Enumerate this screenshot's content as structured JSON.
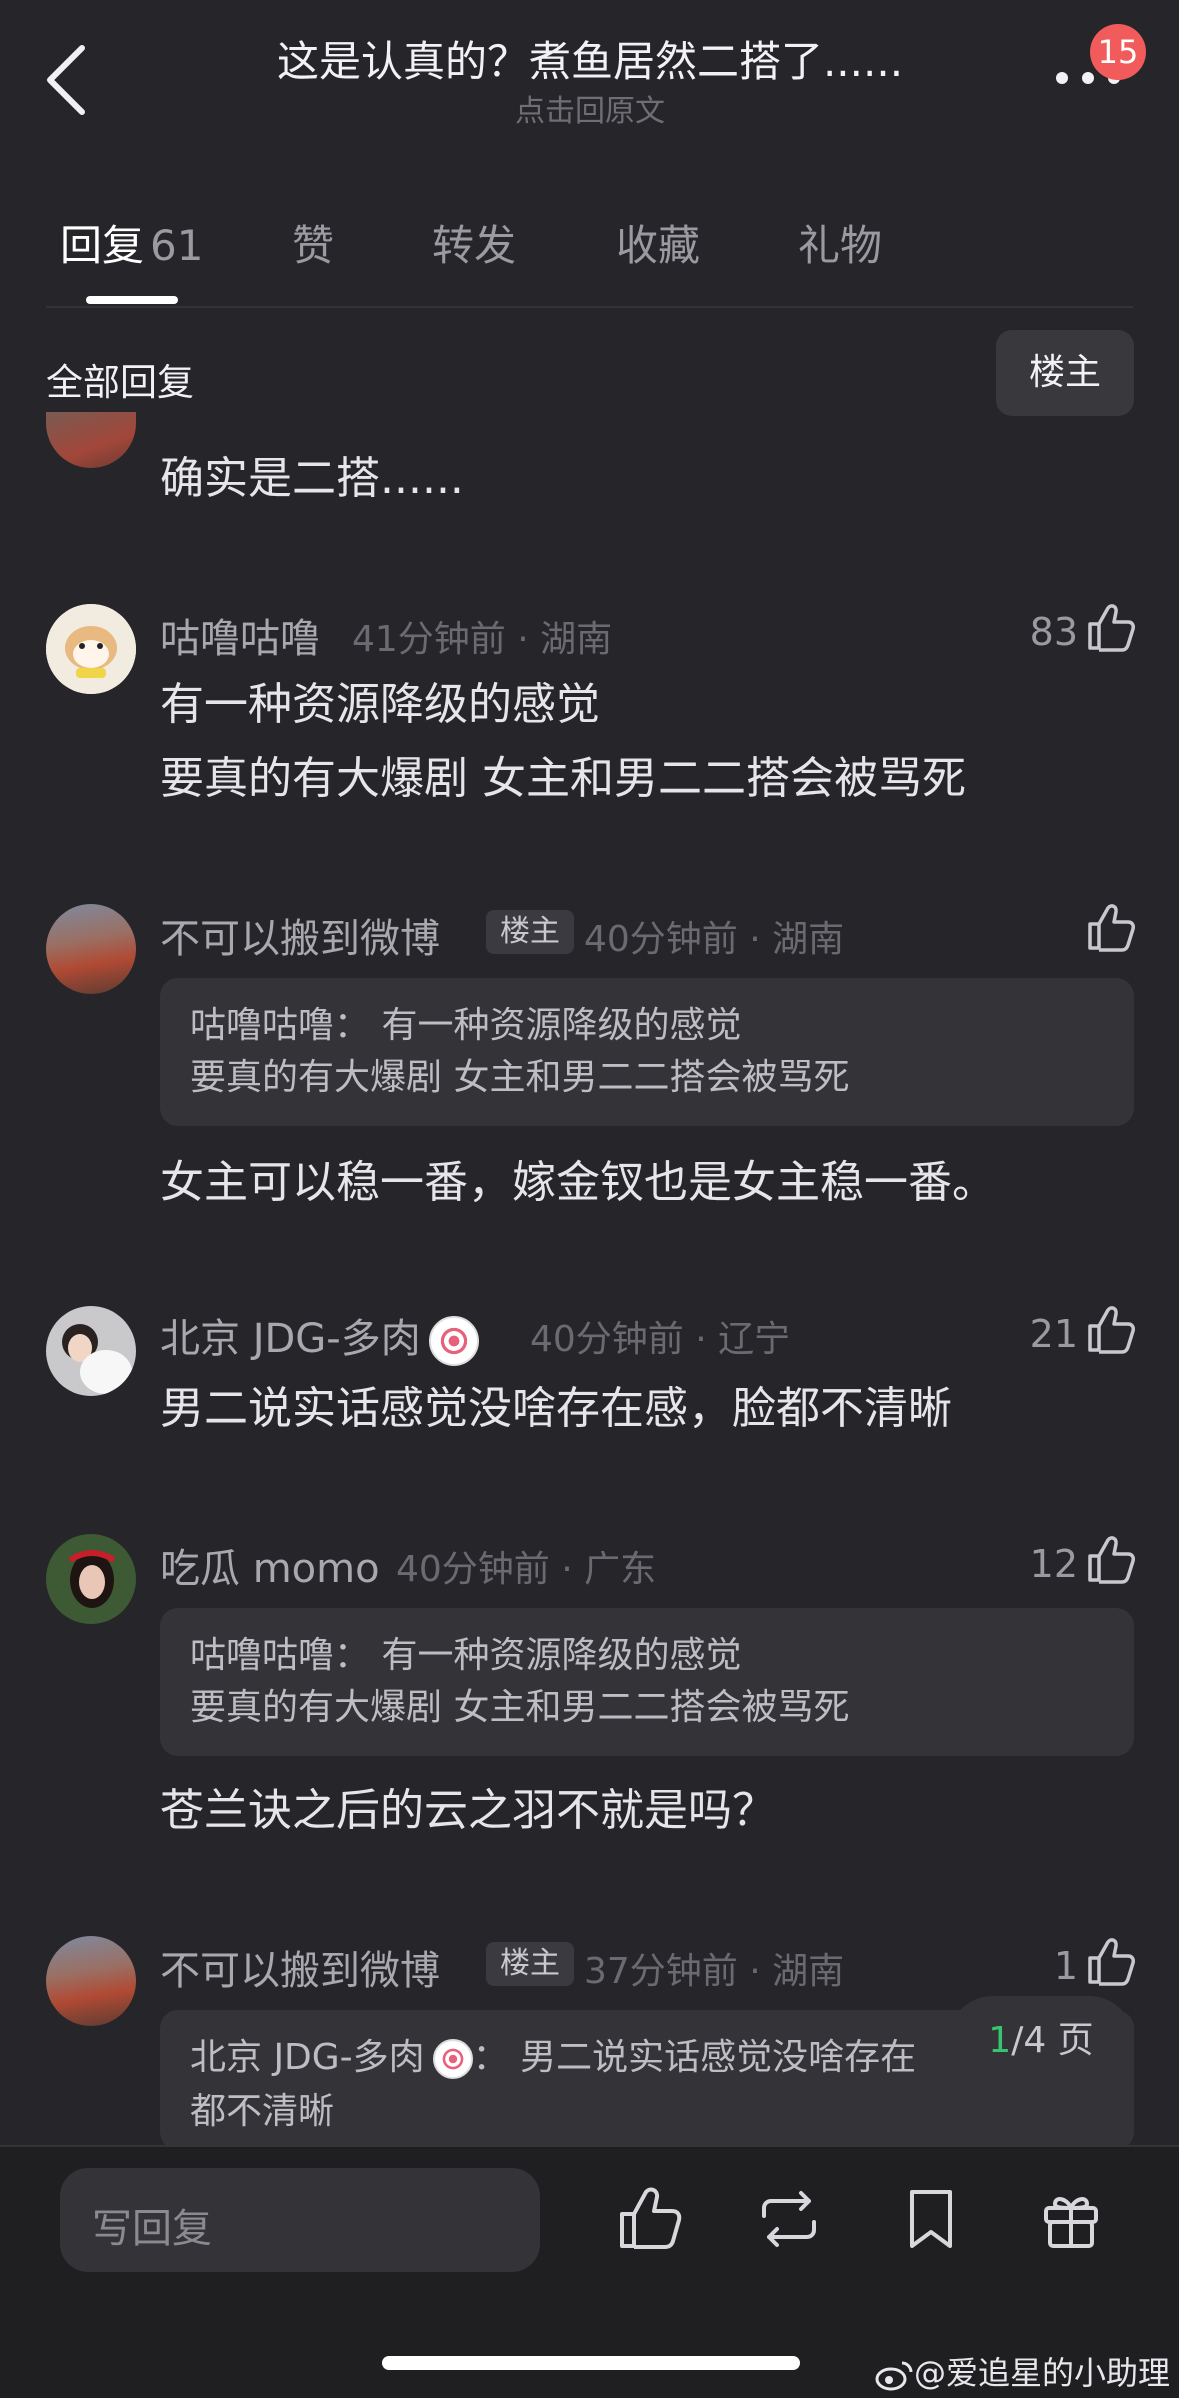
{
  "header": {
    "title": "这是认真的？煮鱼居然二搭了......",
    "subtitle": "点击回原文",
    "badge": "15"
  },
  "tabs": [
    {
      "label": "回复",
      "count": "61"
    },
    {
      "label": "赞"
    },
    {
      "label": "转发"
    },
    {
      "label": "收藏"
    },
    {
      "label": "礼物"
    }
  ],
  "section": {
    "title": "全部回复",
    "filter": "楼主"
  },
  "comments": [
    {
      "body": "确实是二搭......"
    },
    {
      "username": "咕噜咕噜",
      "time": "41分钟前 · 湖南",
      "likes": "83",
      "body": [
        "有一种资源降级的感觉",
        "要真的有大爆剧 女主和男二二搭会被骂死"
      ]
    },
    {
      "username": "不可以搬到微博",
      "tag": "楼主",
      "time": "40分钟前 · 湖南",
      "likes": "",
      "quote": [
        "咕噜咕噜：  有一种资源降级的感觉",
        "要真的有大爆剧 女主和男二二搭会被骂死"
      ],
      "body": [
        "女主可以稳一番，嫁金钗也是女主稳一番。"
      ]
    },
    {
      "username": "北京 JDG-多肉",
      "time": "40分钟前 · 辽宁",
      "likes": "21",
      "body": [
        "男二说实话感觉没啥存在感，脸都不清晰"
      ]
    },
    {
      "username": "吃瓜 momo",
      "time": "40分钟前 · 广东",
      "likes": "12",
      "quote": [
        "咕噜咕噜：  有一种资源降级的感觉",
        "要真的有大爆剧 女主和男二二搭会被骂死"
      ],
      "body": [
        "苍兰诀之后的云之羽不就是吗？"
      ]
    },
    {
      "username": "不可以搬到微博",
      "tag": "楼主",
      "time": "37分钟前 · 湖南",
      "likes": "1",
      "quote_user": "北京 JDG-多肉",
      "quote_rest": "：  男二说实话感觉没啥存在",
      "quote_line2": "都不清晰"
    }
  ],
  "pager": {
    "current": "1",
    "total": "/4 页"
  },
  "bottom": {
    "placeholder": "写回复"
  },
  "watermark": "@爱追星的小助理",
  "colors": {
    "background": "#26262a",
    "badge": "#f15b5b",
    "pager_current": "#37c46e"
  }
}
